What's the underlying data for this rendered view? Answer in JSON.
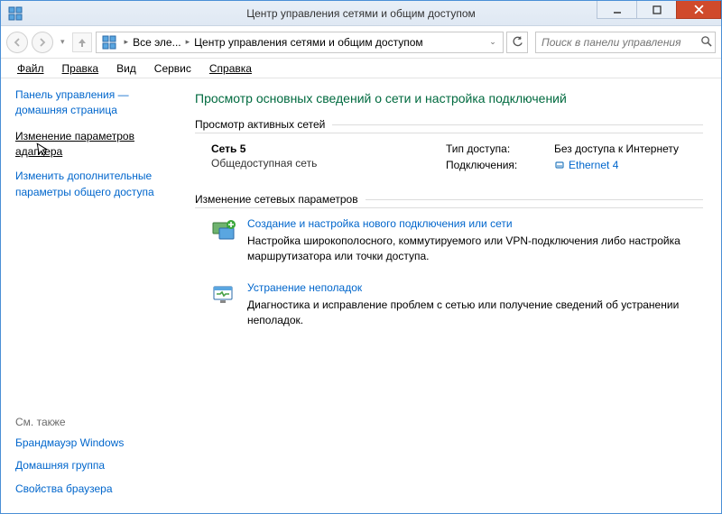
{
  "titlebar": {
    "title": "Центр управления сетями и общим доступом"
  },
  "breadcrumb": {
    "item1": "Все эле...",
    "item2": "Центр управления сетями и общим доступом"
  },
  "search": {
    "placeholder": "Поиск в панели управления"
  },
  "menu": {
    "file": "Файл",
    "edit": "Правка",
    "view": "Вид",
    "tools": "Сервис",
    "help": "Справка"
  },
  "sidebar": {
    "control_home": "Панель управления — домашняя страница",
    "adapter_link": "Изменение параметров адаптера",
    "advanced_link": "Изменить дополнительные параметры общего доступа",
    "see_also_header": "См. также",
    "see_also": {
      "firewall": "Брандмауэр Windows",
      "homegroup": "Домашняя группа",
      "browser": "Свойства браузера"
    }
  },
  "main": {
    "heading": "Просмотр основных сведений о сети и настройка подключений",
    "active_networks_label": "Просмотр активных сетей",
    "network": {
      "name": "Сеть  5",
      "type": "Общедоступная сеть",
      "access_type_label": "Тип доступа:",
      "access_type_value": "Без доступа к Интернету",
      "connections_label": "Подключения:",
      "connections_value": "Ethernet 4"
    },
    "change_params_label": "Изменение сетевых параметров",
    "opt_new": {
      "title": "Создание и настройка нового подключения или сети",
      "desc": "Настройка широкополосного, коммутируемого или VPN-подключения либо настройка маршрутизатора или точки доступа."
    },
    "opt_trouble": {
      "title": "Устранение неполадок",
      "desc": "Диагностика и исправление проблем с сетью или получение сведений об устранении неполадок."
    }
  }
}
